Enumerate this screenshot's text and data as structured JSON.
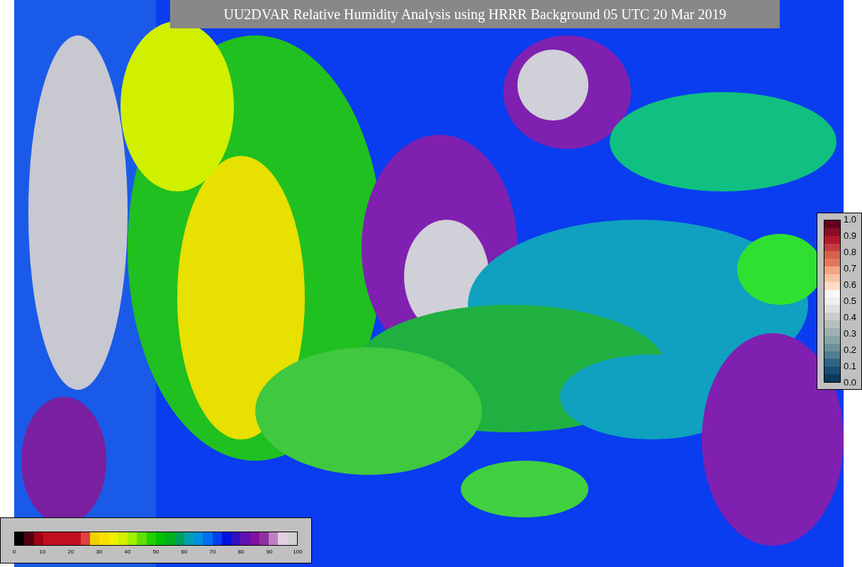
{
  "title": "UU2DVAR Relative Humidity Analysis using HRRR Background 05 UTC 20 Mar 2019",
  "humidity_colorbar": {
    "ticks": [
      "0",
      "10",
      "20",
      "30",
      "40",
      "50",
      "60",
      "70",
      "80",
      "90",
      "100"
    ]
  },
  "value_colorbar": {
    "ticks": [
      "1.0",
      "0.9",
      "0.8",
      "0.7",
      "0.6",
      "0.5",
      "0.4",
      "0.3",
      "0.2",
      "0.1",
      "0.0"
    ]
  }
}
